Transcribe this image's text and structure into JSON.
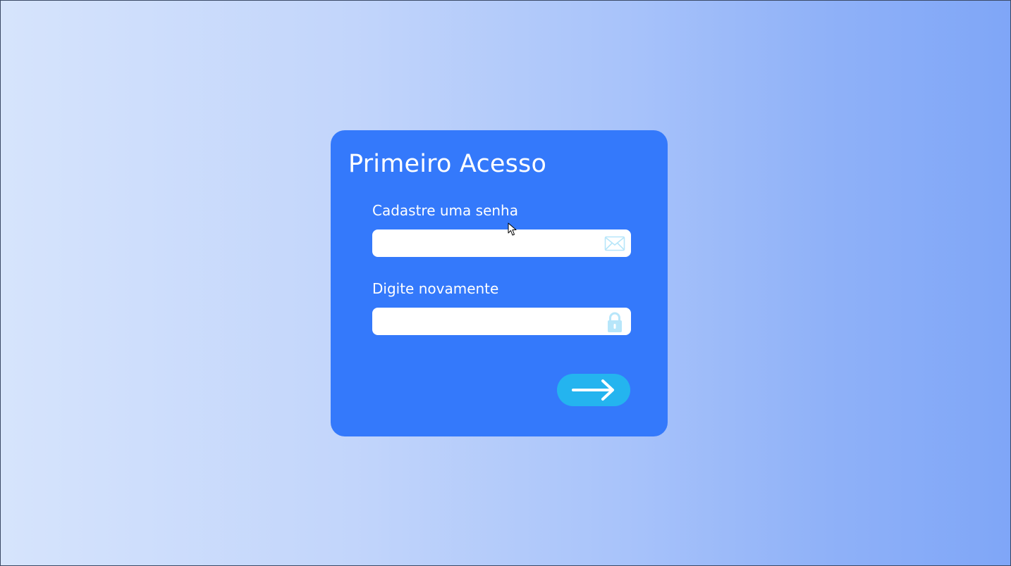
{
  "page": {
    "background_colors": [
      "#d6e4fc",
      "#c2d5fb",
      "#a8c3fa",
      "#8fb1f8",
      "#7fa6f7"
    ]
  },
  "card": {
    "title": "Primeiro Acesso",
    "background_color": "#3479fb"
  },
  "password_field": {
    "label": "Cadastre uma senha",
    "value": "",
    "placeholder": "",
    "icon": "envelope-icon"
  },
  "confirm_field": {
    "label": "Digite novamente",
    "value": "",
    "placeholder": "",
    "icon": "lock-icon"
  },
  "submit": {
    "icon": "arrow-right-icon",
    "color": "#24b4ef"
  },
  "icon_color": "#b7e6fa"
}
